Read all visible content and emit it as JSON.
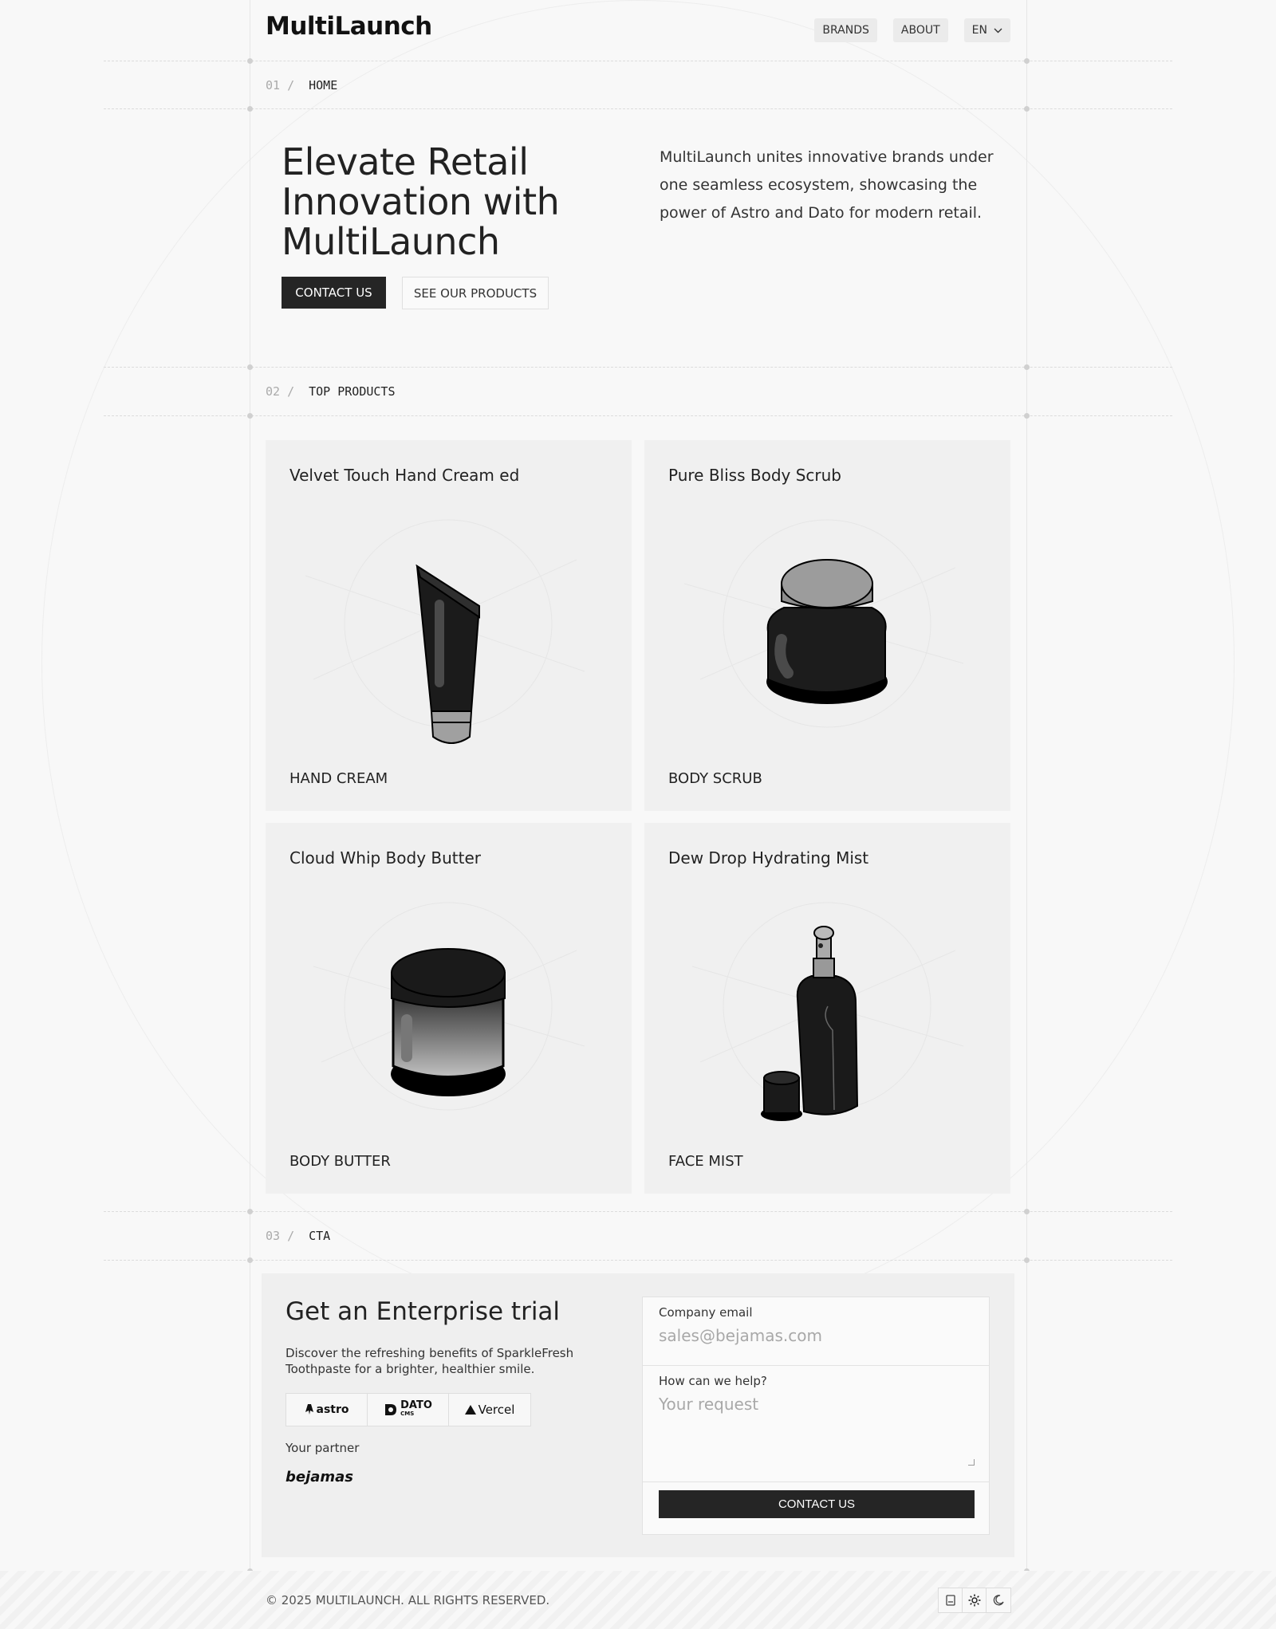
{
  "header": {
    "logo": "MultiLaunch",
    "nav": [
      {
        "label": "BRANDS"
      },
      {
        "label": "ABOUT"
      }
    ],
    "language": "EN"
  },
  "sections": {
    "home": {
      "num": "01 /",
      "label": "HOME"
    },
    "products": {
      "num": "02 /",
      "label": "TOP PRODUCTS"
    },
    "cta": {
      "num": "03 /",
      "label": "CTA"
    }
  },
  "hero": {
    "title": "Elevate Retail Innovation with MultiLaunch",
    "text": "MultiLaunch unites innovative brands under one seamless ecosystem, showcasing the power of Astro and Dato for modern retail.",
    "primary_button": "CONTACT US",
    "secondary_button": "SEE OUR PRODUCTS"
  },
  "products": [
    {
      "title": "Velvet Touch Hand Cream ed",
      "category": "HAND CREAM"
    },
    {
      "title": "Pure Bliss Body Scrub",
      "category": "BODY SCRUB"
    },
    {
      "title": "Cloud Whip Body Butter",
      "category": "BODY BUTTER"
    },
    {
      "title": "Dew Drop Hydrating Mist",
      "category": "FACE MIST"
    }
  ],
  "cta": {
    "title": "Get an Enterprise trial",
    "description": "Discover the refreshing benefits of SparkleFresh Toothpaste for a brighter, healthier smile.",
    "logos": [
      "astro",
      "DATO",
      "Vercel"
    ],
    "dato_sub": "CMS",
    "partner_label": "Your partner",
    "partner_name": "bejamas",
    "form": {
      "email_label": "Company email",
      "email_placeholder": "sales@bejamas.com",
      "help_label": "How can we help?",
      "help_placeholder": "Your request",
      "submit": "CONTACT US"
    }
  },
  "footer": {
    "copyright": "© 2025 MULTILAUNCH. ALL RIGHTS RESERVED."
  },
  "colors": {
    "background": "#f8f8f8",
    "card": "#f0f0f0",
    "button_dark": "#252525"
  },
  "icons": [
    "chevron-down-icon",
    "system-theme-icon",
    "sun-icon",
    "moon-icon"
  ]
}
